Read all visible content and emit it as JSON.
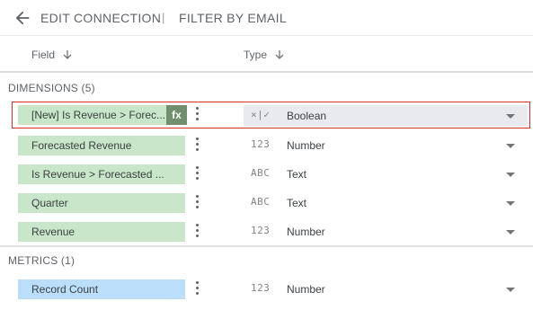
{
  "header": {
    "edit_connection": "EDIT CONNECTION",
    "separator": "|",
    "filter_by_email": "FILTER BY EMAIL"
  },
  "columns": {
    "field": "Field",
    "type": "Type"
  },
  "dimensions_label": "DIMENSIONS (5)",
  "metrics_label": "METRICS (1)",
  "dimensions": [
    {
      "name": "[New] Is Revenue > Forec...",
      "type_icon": "×|✓",
      "type": "Boolean",
      "fx": "fx"
    },
    {
      "name": "Forecasted Revenue",
      "type_icon": "123",
      "type": "Number"
    },
    {
      "name": "Is Revenue > Forecasted ...",
      "type_icon": "ABC",
      "type": "Text"
    },
    {
      "name": "Quarter",
      "type_icon": "ABC",
      "type": "Text"
    },
    {
      "name": "Revenue",
      "type_icon": "123",
      "type": "Number"
    }
  ],
  "metrics": [
    {
      "name": "Record Count",
      "type_icon": "123",
      "type": "Number"
    }
  ],
  "colors": {
    "dimension_chip": "#c8e6c9",
    "metric_chip": "#bbdefb",
    "selected_border": "#d93025",
    "fx_badge": "#6f8f6f"
  }
}
